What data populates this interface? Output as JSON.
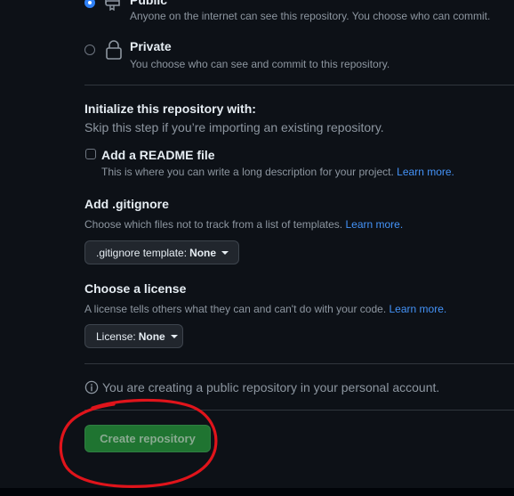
{
  "visibility": {
    "public": {
      "title": "Public",
      "description": "Anyone on the internet can see this repository. You choose who can commit.",
      "selected": true,
      "icon": "repo-icon"
    },
    "private": {
      "title": "Private",
      "description": "You choose who can see and commit to this repository.",
      "selected": false,
      "icon": "lock-icon"
    }
  },
  "initialize": {
    "heading": "Initialize this repository with:",
    "subheading": "Skip this step if you’re importing an existing repository.",
    "readme": {
      "label": "Add a README file",
      "checked": false,
      "description": "This is where you can write a long description for your project.",
      "link": "Learn more."
    }
  },
  "gitignore": {
    "heading": "Add .gitignore",
    "description": "Choose which files not to track from a list of templates.",
    "link": "Learn more.",
    "button_prefix": ".gitignore template:",
    "button_value": "None"
  },
  "license": {
    "heading": "Choose a license",
    "description": "A license tells others what they can and can't do with your code.",
    "link": "Learn more.",
    "button_prefix": "License:",
    "button_value": "None"
  },
  "notice": {
    "text": "You are creating a public repository in your personal account.",
    "icon": "info-icon"
  },
  "submit": {
    "label": "Create repository"
  },
  "colors": {
    "background": "#0d1117",
    "accent_link": "#4493f8",
    "create_button": "#238636",
    "annotation": "#e0141b"
  }
}
